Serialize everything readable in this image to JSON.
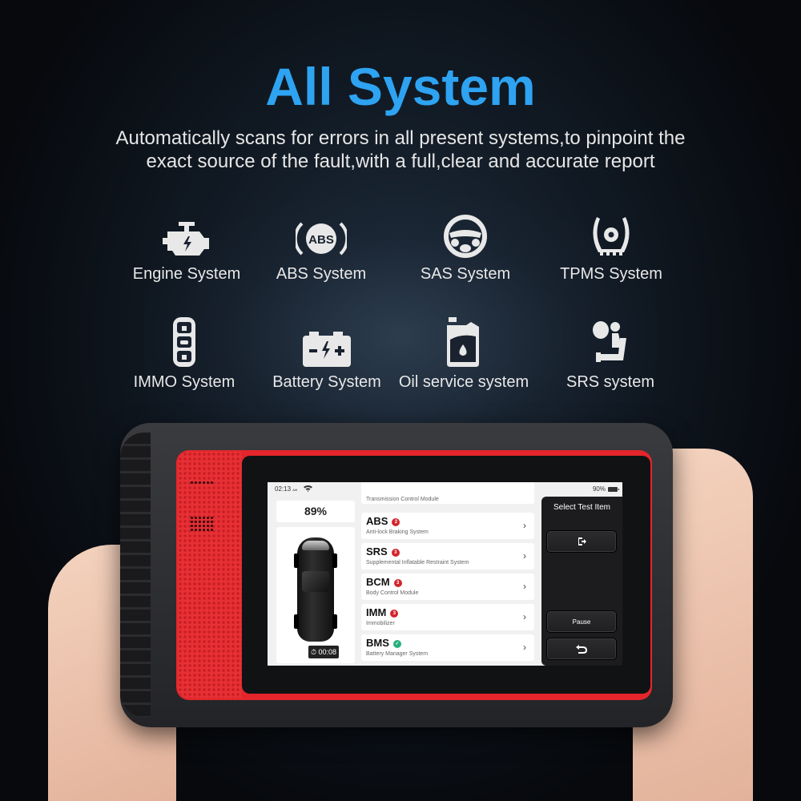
{
  "header": {
    "title": "All System",
    "subtitle_line1": "Automatically scans for errors in all present systems,to pinpoint the",
    "subtitle_line2": "exact source of the fault,with a full,clear and accurate report"
  },
  "features": [
    {
      "label": "Engine System",
      "icon": "engine-icon"
    },
    {
      "label": "ABS System",
      "icon": "abs-icon"
    },
    {
      "label": "SAS System",
      "icon": "steering-wheel-icon"
    },
    {
      "label": "TPMS System",
      "icon": "tire-pressure-icon"
    },
    {
      "label": "IMMO System",
      "icon": "key-fob-icon"
    },
    {
      "label": "Battery System",
      "icon": "battery-icon"
    },
    {
      "label": "Oil service system",
      "icon": "oil-can-icon"
    },
    {
      "label": "SRS system",
      "icon": "airbag-seat-icon"
    }
  ],
  "colors": {
    "accent": "#2ea3f2",
    "device_red": "#e4262c",
    "error_badge": "#d3242a",
    "ok_badge": "#27b07e"
  },
  "device_screen": {
    "status_bar": {
      "time": "02:13",
      "ampm": "AM",
      "battery": "90%"
    },
    "progress": "89%",
    "timer": "00:08",
    "partial_item": "Transmission Control Module",
    "items": [
      {
        "code": "ABS",
        "badge": "2",
        "status": "error",
        "desc": "Anti-lock Braking System"
      },
      {
        "code": "SRS",
        "badge": "3",
        "status": "error",
        "desc": "Supplemental Inflatable Restraint System"
      },
      {
        "code": "BCM",
        "badge": "3",
        "status": "error",
        "desc": "Body Control Module"
      },
      {
        "code": "IMM",
        "badge": "3",
        "status": "error",
        "desc": "Immobilizer"
      },
      {
        "code": "BMS",
        "badge": "✓",
        "status": "ok",
        "desc": "Battery Manager System"
      }
    ],
    "panel": {
      "title": "Select Test Item",
      "pause_label": "Pause"
    }
  }
}
